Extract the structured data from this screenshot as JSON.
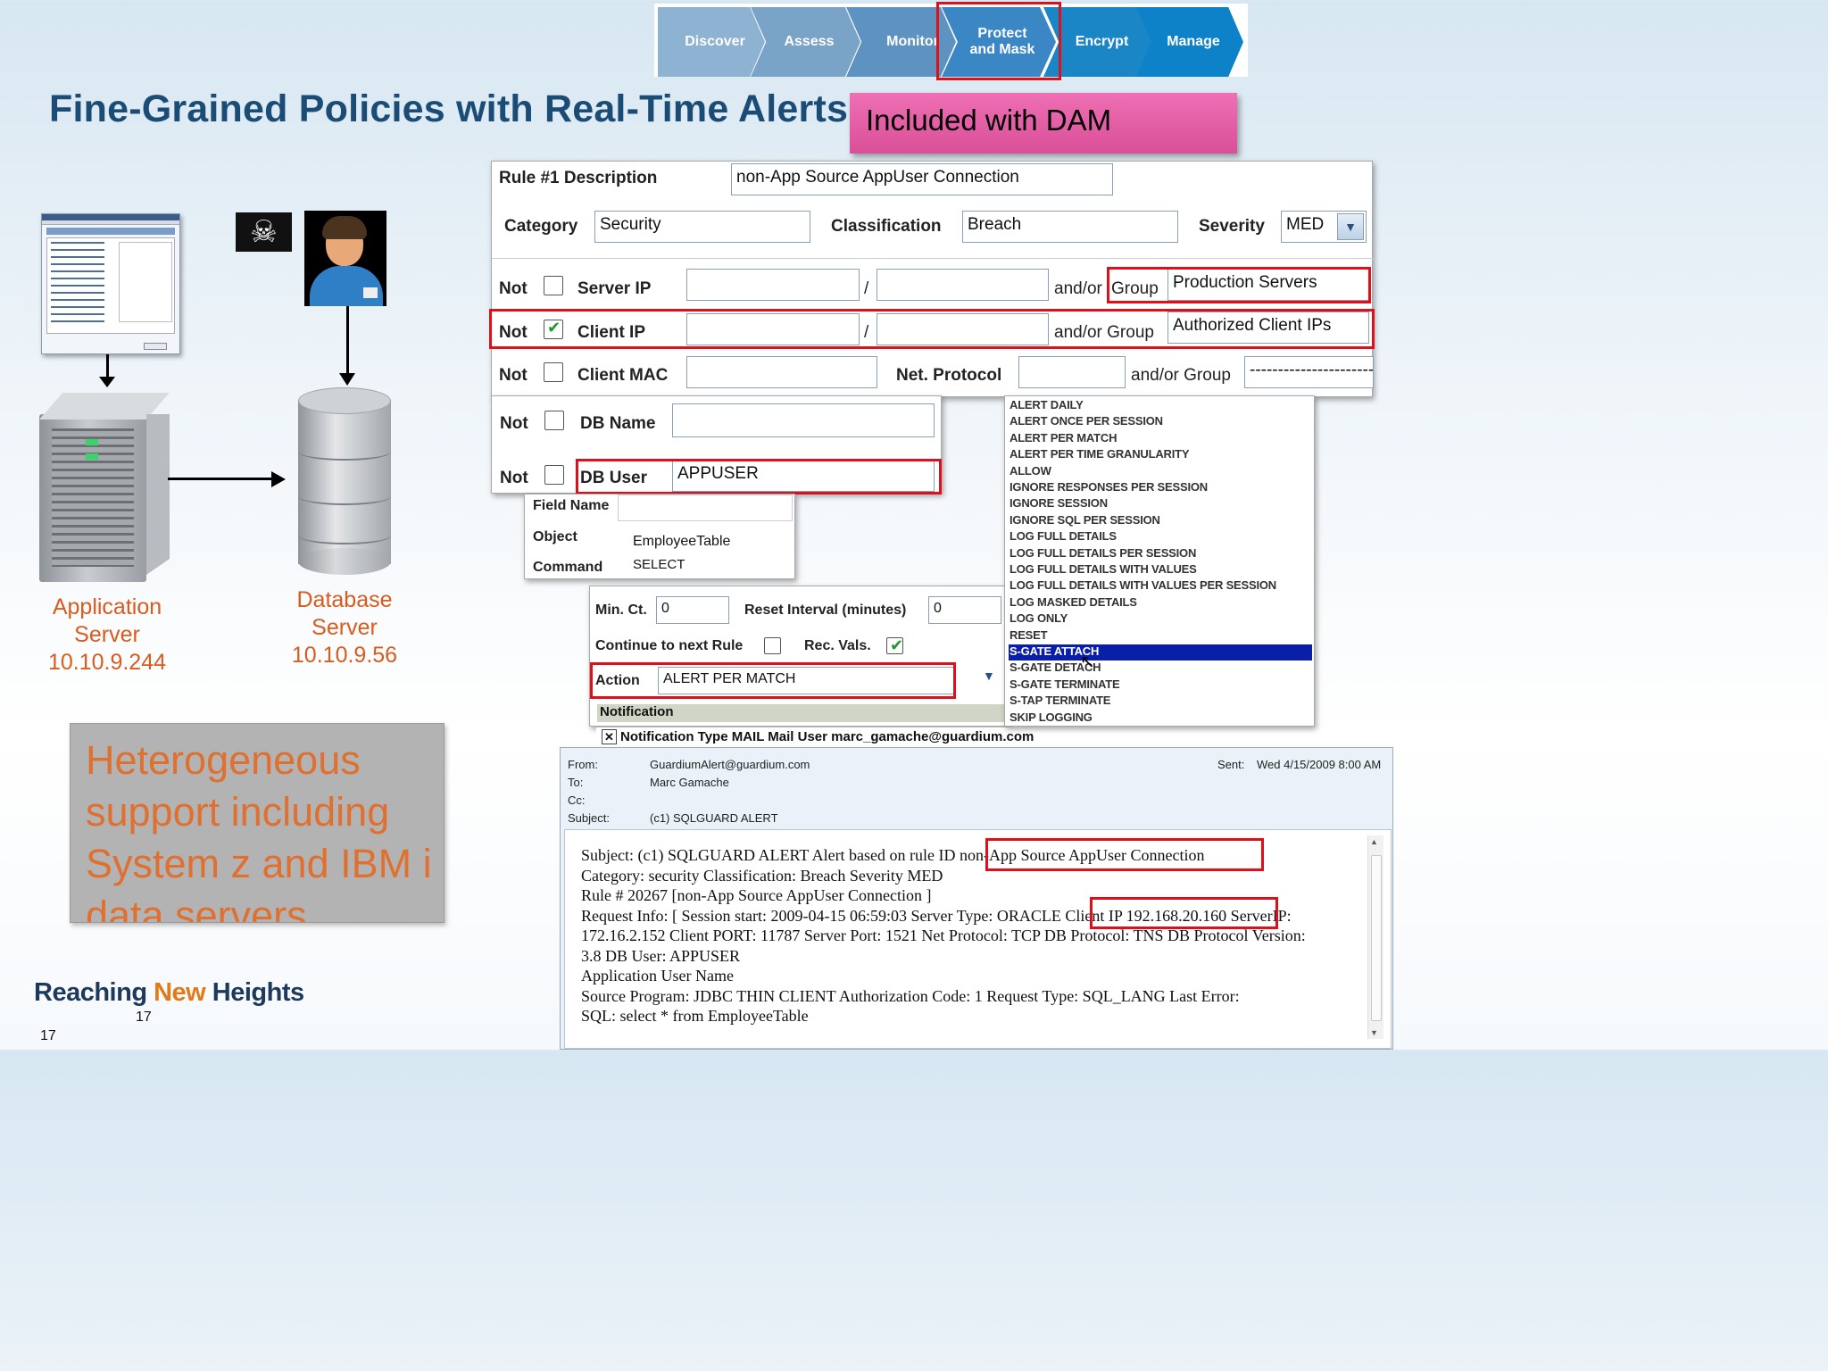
{
  "header": {
    "steps": [
      "Discover",
      "Assess",
      "Monitor",
      "Protect\nand Mask",
      "Encrypt",
      "Manage"
    ],
    "step_colors": [
      "#8eb2d2",
      "#7aa3c8",
      "#5e93c1",
      "#3b86c4",
      "#1a86c6",
      "#0e82c8"
    ],
    "highlighted_step": "Protect\nand Mask"
  },
  "title": "Fine-Grained Policies with Real-Time Alerts",
  "badge": "Included with DAM",
  "diagram": {
    "app_server_label": "Application\nServer\n10.10.9.244",
    "db_server_label": "Database\nServer\n10.10.9.56"
  },
  "callout": "Heterogeneous support including System z and IBM i data servers",
  "rule_form": {
    "rule_label": "Rule #1 Description",
    "rule_value": "non-App Source AppUser Connection",
    "category_label": "Category",
    "category_value": "Security",
    "classification_label": "Classification",
    "classification_value": "Breach",
    "severity_label": "Severity",
    "severity_value": "MED",
    "not_label": "Not",
    "server_ip_label": "Server IP",
    "client_ip_label": "Client IP",
    "client_mac_label": "Client MAC",
    "slash": "/",
    "andor_group_label": "and/or Group",
    "andor_label": "and/or",
    "group_label": "Group",
    "server_group_value": "Production Servers",
    "client_group_value": "Authorized Client IPs",
    "net_protocol_label": "Net. Protocol",
    "mac_group_value": "--------------------------",
    "db_name_label": "DB Name",
    "db_user_label": "DB User",
    "db_user_value": "APPUSER",
    "field_name_label": "Field Name",
    "object_label": "Object",
    "object_value": "EmployeeTable",
    "command_label": "Command",
    "command_value": "SELECT",
    "min_ct_label": "Min. Ct.",
    "min_ct_value": "0",
    "reset_interval_label": "Reset Interval (minutes)",
    "reset_interval_value": "0",
    "continue_label": "Continue to next Rule",
    "rec_vals_label": "Rec. Vals.",
    "action_label": "Action",
    "action_value": "ALERT PER MATCH",
    "notification_header": "Notification",
    "notification_line": "Notification Type MAIL  Mail User marc_gamache@guardium.com"
  },
  "action_options": [
    "ALERT DAILY",
    "ALERT ONCE PER SESSION",
    "ALERT PER MATCH",
    "ALERT PER TIME GRANULARITY",
    "ALLOW",
    "IGNORE RESPONSES PER SESSION",
    "IGNORE SESSION",
    "IGNORE SQL PER SESSION",
    "LOG FULL DETAILS",
    "LOG FULL DETAILS PER SESSION",
    "LOG FULL DETAILS WITH VALUES",
    "LOG FULL DETAILS WITH VALUES PER SESSION",
    "LOG MASKED DETAILS",
    "LOG ONLY",
    "RESET",
    "S-GATE ATTACH",
    "S-GATE DETACH",
    "S-GATE TERMINATE",
    "S-TAP TERMINATE",
    "SKIP LOGGING"
  ],
  "selected_action_option": "S-GATE ATTACH",
  "email": {
    "from_label": "From:",
    "from_value": "GuardiumAlert@guardium.com",
    "to_label": "To:",
    "to_value": "Marc Gamache",
    "cc_label": "Cc:",
    "subject_label": "Subject:",
    "subject_value": "(c1) SQLGUARD ALERT",
    "sent_label": "Sent:",
    "sent_value": "Wed 4/15/2009 8:00 AM",
    "body_lines": [
      "Subject: (c1) SQLGUARD ALERT Alert based on rule ID non-App Source AppUser Connection",
      "Category: security Classification: Breach Severity MED",
      "Rule # 20267 [non-App Source AppUser Connection ]",
      "Request Info: [ Session start: 2009-04-15 06:59:03 Server Type: ORACLE Client IP 192.168.20.160 ServerIP:",
      "172.16.2.152 Client PORT: 11787 Server Port: 1521 Net Protocol: TCP DB Protocol: TNS DB Protocol Version:",
      "3.8 DB User: APPUSER",
      "Application User Name",
      "Source Program: JDBC THIN CLIENT Authorization Code: 1 Request Type: SQL_LANG Last Error:",
      "SQL: select * from EmployeeTable"
    ]
  },
  "footer": {
    "brand_part1": "Reaching ",
    "brand_part2": "New",
    "brand_part3": " Heights",
    "page_number_a": "17",
    "page_number_b": "17"
  }
}
